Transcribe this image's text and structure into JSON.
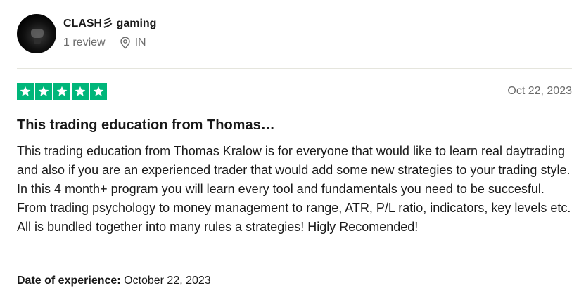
{
  "reviewer": {
    "name": "CLASH彡 gaming",
    "review_count": "1 review",
    "location": "IN"
  },
  "review": {
    "rating": 5,
    "rating_color": "#00b67a",
    "date": "Oct 22, 2023",
    "title": "This trading education from Thomas…",
    "body": "This trading education from Thomas Kralow is for everyone that would like to learn real daytrading and also if you are an experienced trader that would add some new strategies to your trading style. In this 4 month+ program you will learn every tool and fundamentals you need to be succesful. From trading psychology to money management to range, ATR, P/L ratio, indicators, key levels etc. All is bundled together into many rules a strategies! Higly Recomended!",
    "experience_label": "Date of experience:",
    "experience_date": "October 22, 2023"
  },
  "icons": {
    "location": "location-pin-icon",
    "star": "star-icon"
  }
}
